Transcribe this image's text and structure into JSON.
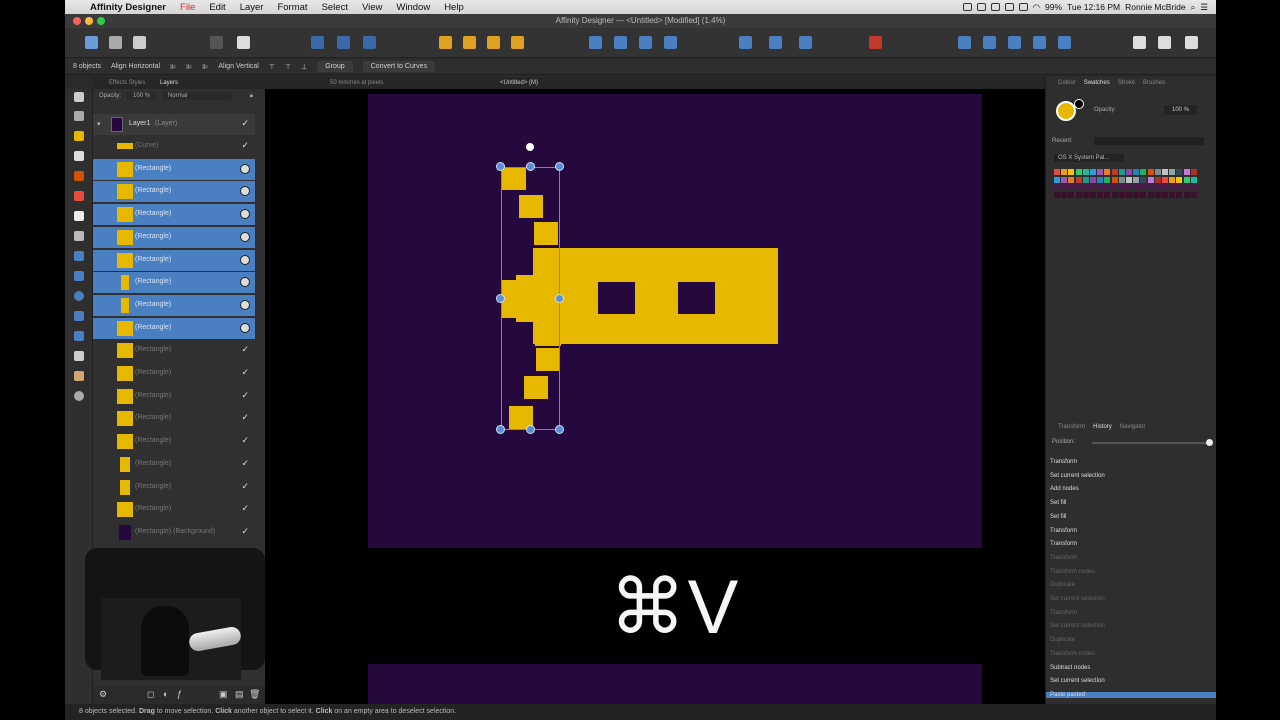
{
  "menubar": {
    "app_name": "Affinity Designer",
    "items": [
      "File",
      "Edit",
      "Layer",
      "Format",
      "Select",
      "View",
      "Window",
      "Help"
    ],
    "battery": "99%",
    "clock": "Tue 12:16 PM",
    "user": "Ronnie McBride"
  },
  "window": {
    "title": "Affinity Designer — <Untitled> [Modified] (1.4%)"
  },
  "contextbar": {
    "selection_count": "8 objects",
    "align_horizontal": "Align Horizontal",
    "align_vertical": "Align Vertical",
    "group": "Group",
    "convert": "Convert to Curves"
  },
  "tabs": {
    "left": "Effects  Styles",
    "active": "Layers",
    "center_hint": "50 mm/min at pixels",
    "doc": "<Untitled> (M)"
  },
  "layers": {
    "opacity_label": "Opacity:",
    "opacity_value": "100 %",
    "blend": "Normal",
    "top_layer": "Layer1",
    "top_layer_suffix": "(Layer)",
    "items": [
      {
        "name": "(Curve)"
      },
      {
        "name": "(Rectangle)"
      },
      {
        "name": "(Rectangle)"
      },
      {
        "name": "(Rectangle)"
      },
      {
        "name": "(Rectangle)"
      },
      {
        "name": "(Rectangle)"
      },
      {
        "name": "(Rectangle)"
      },
      {
        "name": "(Rectangle)"
      },
      {
        "name": "(Rectangle)"
      },
      {
        "name": "(Rectangle)"
      },
      {
        "name": "(Rectangle)"
      },
      {
        "name": "(Rectangle)"
      },
      {
        "name": "(Rectangle)"
      },
      {
        "name": "(Rectangle)"
      },
      {
        "name": "(Rectangle)"
      },
      {
        "name": "(Rectangle)"
      },
      {
        "name": "(Rectangle)"
      },
      {
        "name": "(Rectangle) (Background)"
      }
    ]
  },
  "shortcut": {
    "keys": "⌘V"
  },
  "swatches": {
    "tabs": [
      "Colour",
      "Swatches",
      "Stroke",
      "Brushes"
    ],
    "active_tab": "Swatches",
    "opacity_label": "Opacity:",
    "opacity_value": "100 %",
    "recent_label": "Recent:",
    "palette": "OS X System Pal..."
  },
  "history": {
    "tabs": [
      "Transform",
      "History",
      "Navigator"
    ],
    "active_tab": "History",
    "position_label": "Position:",
    "items": [
      {
        "label": "Transform"
      },
      {
        "label": "Set current selection"
      },
      {
        "label": "Add nodes"
      },
      {
        "label": "Set fill"
      },
      {
        "label": "Set fill"
      },
      {
        "label": "Transform"
      },
      {
        "label": "Transform"
      },
      {
        "label": "Transform"
      },
      {
        "label": "Transform nodes"
      },
      {
        "label": "Duplicate"
      },
      {
        "label": "Set current selection"
      },
      {
        "label": "Transform"
      },
      {
        "label": "Set current selection"
      },
      {
        "label": "Duplicate"
      },
      {
        "label": "Transform nodes"
      },
      {
        "label": "Subtract nodes"
      },
      {
        "label": "Set current selection"
      },
      {
        "label": "Paste pasted"
      }
    ]
  },
  "status": {
    "prefix": "8 objects selected.",
    "drag": "Drag",
    "drag_text": "to move selection.",
    "click": "Click",
    "click_text": "another object to select it.",
    "click2": "Click",
    "click2_text": "on an empty area to deselect selection."
  },
  "colors": {
    "accent": "#4a7fc1",
    "shape": "#e6b800",
    "artboard": "#25083e"
  }
}
